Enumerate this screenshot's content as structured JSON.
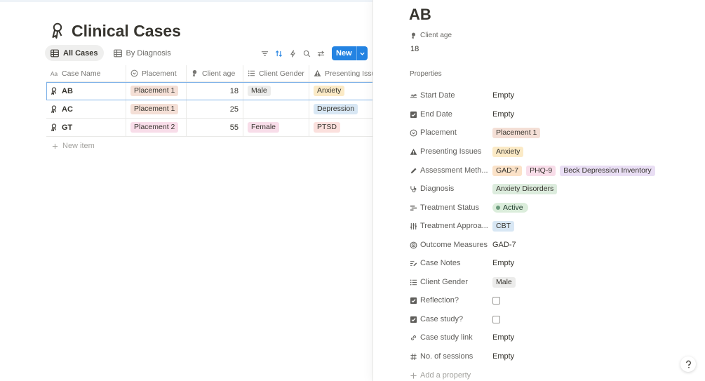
{
  "database": {
    "title": "Clinical Cases",
    "icon": "ribbon-person-icon",
    "views": [
      {
        "label": "All Cases",
        "icon": "table-icon",
        "active": true
      },
      {
        "label": "By Diagnosis",
        "icon": "table-icon",
        "active": false
      }
    ],
    "toolbar": {
      "icons": [
        "filter-icon",
        "sort-icon",
        "lightning-icon",
        "search-icon",
        "settings-sliders-icon"
      ],
      "new_label": "New"
    },
    "columns": [
      {
        "label": "Case Name",
        "icon": "text-type-icon"
      },
      {
        "label": "Placement",
        "icon": "circle-select-icon"
      },
      {
        "label": "Client age",
        "icon": "person-icon"
      },
      {
        "label": "Client Gender",
        "icon": "list-icon"
      },
      {
        "label": "Presenting Issues",
        "icon": "warning-icon"
      }
    ],
    "rows": [
      {
        "name": "AB",
        "placement": "Placement 1",
        "age": "18",
        "gender": "Male",
        "issue": "Anxiety"
      },
      {
        "name": "AC",
        "placement": "Placement 1",
        "age": "25",
        "gender": "",
        "issue": "Depression"
      },
      {
        "name": "GT",
        "placement": "Placement 2",
        "age": "55",
        "gender": "Female",
        "issue": "PTSD"
      }
    ],
    "new_item_label": "New item"
  },
  "peek": {
    "title": "AB",
    "client_age_label": "Client age",
    "client_age_value": "18",
    "properties_heading": "Properties",
    "properties": [
      {
        "label": "Start Date",
        "icon": "plane-icon",
        "value": "Empty",
        "empty": true
      },
      {
        "label": "End Date",
        "icon": "checkbox-icon",
        "value": "Empty",
        "empty": true
      },
      {
        "label": "Placement",
        "icon": "circle-select-icon",
        "tags": [
          {
            "text": "Placement 1",
            "color": "#f4dfd6"
          }
        ]
      },
      {
        "label": "Presenting Issues",
        "icon": "warning-icon",
        "tags": [
          {
            "text": "Anxiety",
            "color": "#fbeac6"
          }
        ]
      },
      {
        "label": "Assessment Meth...",
        "icon": "pencil-icon",
        "tags": [
          {
            "text": "GAD-7",
            "color": "#fbe2c8"
          },
          {
            "text": "PHQ-9",
            "color": "#f8dde9"
          },
          {
            "text": "Beck Depression Inventory",
            "color": "#e9def4"
          }
        ]
      },
      {
        "label": "Diagnosis",
        "icon": "stethoscope-icon",
        "tags": [
          {
            "text": "Anxiety Disorders",
            "color": "#dcecdd"
          }
        ]
      },
      {
        "label": "Treatment Status",
        "icon": "status-icon",
        "status": "Active"
      },
      {
        "label": "Treatment Approa...",
        "icon": "sliders-icon",
        "tags": [
          {
            "text": "CBT",
            "color": "#d8e7f4"
          }
        ]
      },
      {
        "label": "Outcome Measures",
        "icon": "target-icon",
        "value": "GAD-7",
        "empty": false
      },
      {
        "label": "Case Notes",
        "icon": "notes-icon",
        "value": "Empty",
        "empty": true
      },
      {
        "label": "Client Gender",
        "icon": "list-icon",
        "tags": [
          {
            "text": "Male",
            "color": "#ececeb"
          }
        ]
      },
      {
        "label": "Reflection?",
        "icon": "checkbox-icon",
        "checkbox": true
      },
      {
        "label": "Case study?",
        "icon": "checkbox-icon",
        "checkbox": true
      },
      {
        "label": "Case study link",
        "icon": "link-icon",
        "value": "Empty",
        "empty": true
      },
      {
        "label": "No. of sessions",
        "icon": "hash-icon",
        "value": "Empty",
        "empty": true
      }
    ],
    "add_property_label": "Add a property"
  },
  "colors": {
    "accent": "#2383e2",
    "placement_1": "#f4dfd6",
    "placement_2": "#f8dde9",
    "male": "#ececeb",
    "female": "#f8dde9",
    "anxiety": "#fbeac6",
    "depression": "#d8e7f4",
    "ptsd": "#fbe0dd"
  },
  "help_icon": "question-mark-icon"
}
